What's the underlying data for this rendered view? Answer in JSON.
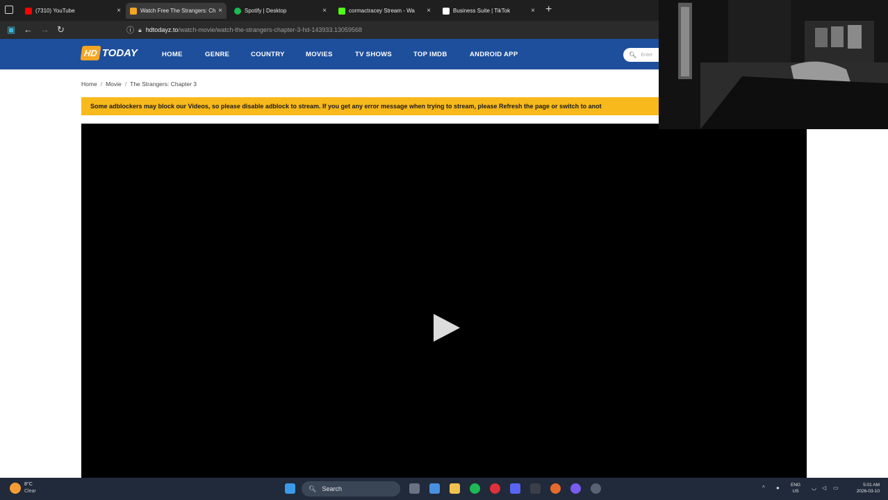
{
  "browser": {
    "tabs": [
      {
        "title": "(7310) YouTube",
        "favicon": "youtube-icon",
        "color": "#ff0000",
        "active": false
      },
      {
        "title": "Watch Free The Strangers: Chap",
        "favicon": "hdtoday-icon",
        "color": "#f5a623",
        "active": true
      },
      {
        "title": "Spotify | Desktop",
        "favicon": "spotify-icon",
        "color": "#1db954",
        "active": false
      },
      {
        "title": "cormactracey Stream - Wa",
        "favicon": "kick-icon",
        "color": "#53fc18",
        "active": false
      },
      {
        "title": "Business Suite | TikTok",
        "favicon": "tiktok-icon",
        "color": "#ffffff",
        "active": false
      }
    ],
    "url_domain": "hdtodayz.to",
    "url_path": "/watch-movie/watch-the-strangers-chapter-3-hd-143933.13059568"
  },
  "site": {
    "logo_hd": "HD",
    "logo_today": "TODAY",
    "nav": [
      "HOME",
      "GENRE",
      "COUNTRY",
      "MOVIES",
      "TV SHOWS",
      "TOP IMDB",
      "ANDROID APP"
    ],
    "search_placeholder": "Enter"
  },
  "breadcrumb": [
    "Home",
    "Movie",
    "The Strangers: Chapter 3"
  ],
  "notice": "Some adblockers may block our Videos, so please disable adblock to stream. If you get any error message when trying to stream, please Refresh the page or switch to anot",
  "taskbar": {
    "weather_temp": "8°C",
    "weather_cond": "Clear",
    "search_label": "Search",
    "lang_line1": "ENG",
    "lang_line2": "US",
    "time": "5:01 AM",
    "date": "2026-03-10"
  },
  "colors": {
    "header": "#1e4f9c",
    "notice": "#f7b91b",
    "accent": "#f5a623"
  }
}
